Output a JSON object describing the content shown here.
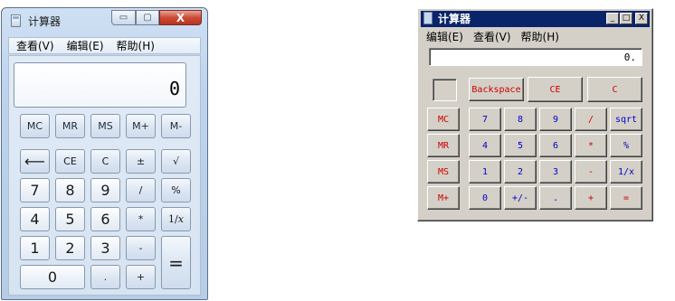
{
  "win7": {
    "title": "计算器",
    "caption": {
      "min": "▭",
      "max": "▢",
      "close": "X"
    },
    "menu": [
      "查看(V)",
      "编辑(E)",
      "帮助(H)"
    ],
    "display": "0",
    "buttons": {
      "mc": "MC",
      "mr": "MR",
      "ms": "MS",
      "mplus": "M+",
      "mminus": "M-",
      "back": "⟵",
      "ce": "CE",
      "c": "C",
      "pm": "±",
      "sqrt": "√",
      "n7": "7",
      "n8": "8",
      "n9": "9",
      "div": "/",
      "pct": "%",
      "n4": "4",
      "n5": "5",
      "n6": "6",
      "mul": "*",
      "recip": "1/𝑥",
      "n1": "1",
      "n2": "2",
      "n3": "3",
      "sub": "-",
      "eq": "=",
      "n0": "0",
      "dot": ".",
      "add": "+"
    }
  },
  "xp": {
    "title": "计算器",
    "caption": {
      "min": "_",
      "max": "□",
      "close": "X"
    },
    "menu": [
      "编辑(E)",
      "查看(V)",
      "帮助(H)"
    ],
    "display": "0.",
    "buttons": {
      "backspace": "Backspace",
      "ce": "CE",
      "c": "C",
      "mc": "MC",
      "n7": "7",
      "n8": "8",
      "n9": "9",
      "div": "/",
      "sqrt": "sqrt",
      "mr": "MR",
      "n4": "4",
      "n5": "5",
      "n6": "6",
      "mul": "*",
      "pct": "%",
      "ms": "MS",
      "n1": "1",
      "n2": "2",
      "n3": "3",
      "sub": "-",
      "recip": "1/x",
      "mplus": "M+",
      "n0": "0",
      "pm": "+/-",
      "dot": ".",
      "add": "+",
      "eq": "="
    }
  }
}
